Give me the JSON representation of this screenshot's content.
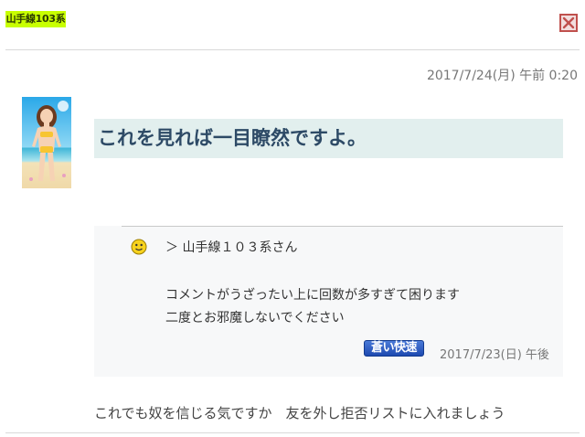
{
  "user": {
    "badge_label": "山手線103系"
  },
  "post": {
    "date": "2017/7/24(月) 午前 0:20",
    "headline": "これを見れば一目瞭然ですよ。",
    "body": "これでも奴を信じる気ですか　友を外し拒否リストに入れましょう"
  },
  "quote": {
    "reply_to": "＞ 山手線１０３系さん",
    "line1": "コメントがうざったい上に回数が多すぎて困ります",
    "line2": "二度とお邪魔しないでください",
    "tag_button_label": "蒼い快速",
    "date": "2017/7/23(日) 午後"
  },
  "icons": {
    "close": "close-icon",
    "smiley": "smiley-icon",
    "avatar": "avatar-image"
  },
  "colors": {
    "badge_bg": "#c8ff00",
    "close_border": "#c0504d",
    "headline_bg": "#e2efee",
    "headline_text": "#2d4a66",
    "tag_button_bg": "#1d49b0"
  }
}
